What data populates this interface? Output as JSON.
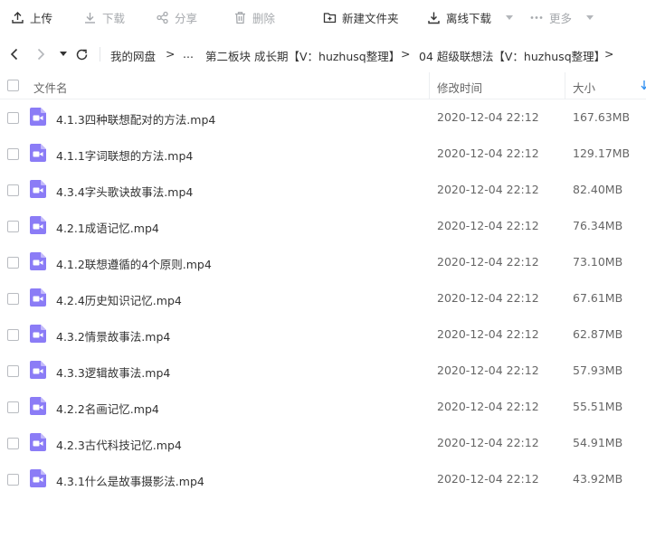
{
  "toolbar": {
    "upload": "上传",
    "download": "下载",
    "share": "分享",
    "delete": "删除",
    "new_folder": "新建文件夹",
    "offline_download": "离线下载",
    "more": "更多"
  },
  "breadcrumb": {
    "root": "我的网盘",
    "sep": ">",
    "ellipsis": "...",
    "level1": "第二板块 成长期【V：huzhusq整理】",
    "level2": "04 超级联想法【V：huzhusq整理】"
  },
  "table": {
    "col_name": "文件名",
    "col_modified": "修改时间",
    "col_size": "大小",
    "rows": [
      {
        "name": "4.1.3四种联想配对的方法.mp4",
        "modified": "2020-12-04 22:12",
        "size": "167.63MB"
      },
      {
        "name": "4.1.1字词联想的方法.mp4",
        "modified": "2020-12-04 22:12",
        "size": "129.17MB"
      },
      {
        "name": "4.3.4字头歌诀故事法.mp4",
        "modified": "2020-12-04 22:12",
        "size": "82.40MB"
      },
      {
        "name": "4.2.1成语记忆.mp4",
        "modified": "2020-12-04 22:12",
        "size": "76.34MB"
      },
      {
        "name": "4.1.2联想遵循的4个原则.mp4",
        "modified": "2020-12-04 22:12",
        "size": "73.10MB"
      },
      {
        "name": "4.2.4历史知识记忆.mp4",
        "modified": "2020-12-04 22:12",
        "size": "67.61MB"
      },
      {
        "name": "4.3.2情景故事法.mp4",
        "modified": "2020-12-04 22:12",
        "size": "62.87MB"
      },
      {
        "name": "4.3.3逻辑故事法.mp4",
        "modified": "2020-12-04 22:12",
        "size": "57.93MB"
      },
      {
        "name": "4.2.2名画记忆.mp4",
        "modified": "2020-12-04 22:12",
        "size": "55.51MB"
      },
      {
        "name": "4.2.3古代科技记忆.mp4",
        "modified": "2020-12-04 22:12",
        "size": "54.91MB"
      },
      {
        "name": "4.3.1什么是故事摄影法.mp4",
        "modified": "2020-12-04 22:12",
        "size": "43.92MB"
      }
    ]
  },
  "colors": {
    "video_icon": "#8b7cf6",
    "accent": "#2a8cf0",
    "disabled": "#a6a9ad"
  },
  "icons": {
    "upload": "upload-icon",
    "download": "download-icon",
    "share": "share-icon",
    "delete": "trash-icon",
    "new_folder": "new-folder-icon",
    "offline_download": "offline-download-icon",
    "more": "more-dots-icon",
    "file": "video-file-icon"
  }
}
